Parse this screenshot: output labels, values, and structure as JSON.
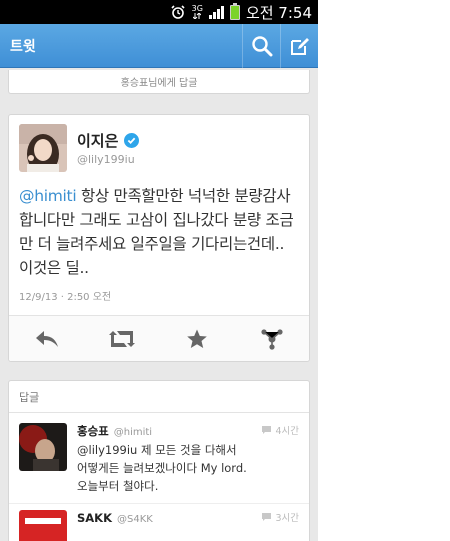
{
  "statusbar": {
    "network": "3G",
    "time": "오전 7:54"
  },
  "appbar": {
    "title": "트윗"
  },
  "reply_to": {
    "text": "홍승표님에게 답글"
  },
  "tweet": {
    "name": "이지은",
    "handle": "@lily199iu",
    "mention": "@himiti",
    "body": " 항상 만족할만한 넉넉한 분량감사합니다만 그래도 고삼이 집나갔다 분량 조금만 더 늘려주세요 일주일을 기다리는건데.. 이것은 딜..",
    "timestamp": "12/9/13 · 2:50 오전"
  },
  "replies": {
    "header": "답글",
    "items": [
      {
        "name": "홍승표",
        "handle": "@himiti",
        "time": "4시간",
        "text_line1": "@lily199iu 제 모든 것을 다해서",
        "text_line2": "어떻게든 늘려보겠나이다 My lord.",
        "text_line3": "오늘부터 철야다."
      },
      {
        "name": "SAKK",
        "handle": "@S4KK",
        "time": "3시간"
      }
    ]
  },
  "colors": {
    "appbar": "#3f8fd6",
    "mention": "#3a8fd0",
    "verified": "#2ea5ea",
    "battery": "#7bd32a"
  },
  "icons": [
    "alarm-icon",
    "signal-icon",
    "battery-icon",
    "search-icon",
    "compose-icon",
    "verified-icon",
    "reply-icon",
    "retweet-icon",
    "favorite-icon",
    "more-icon",
    "speech-bubble-icon"
  ]
}
